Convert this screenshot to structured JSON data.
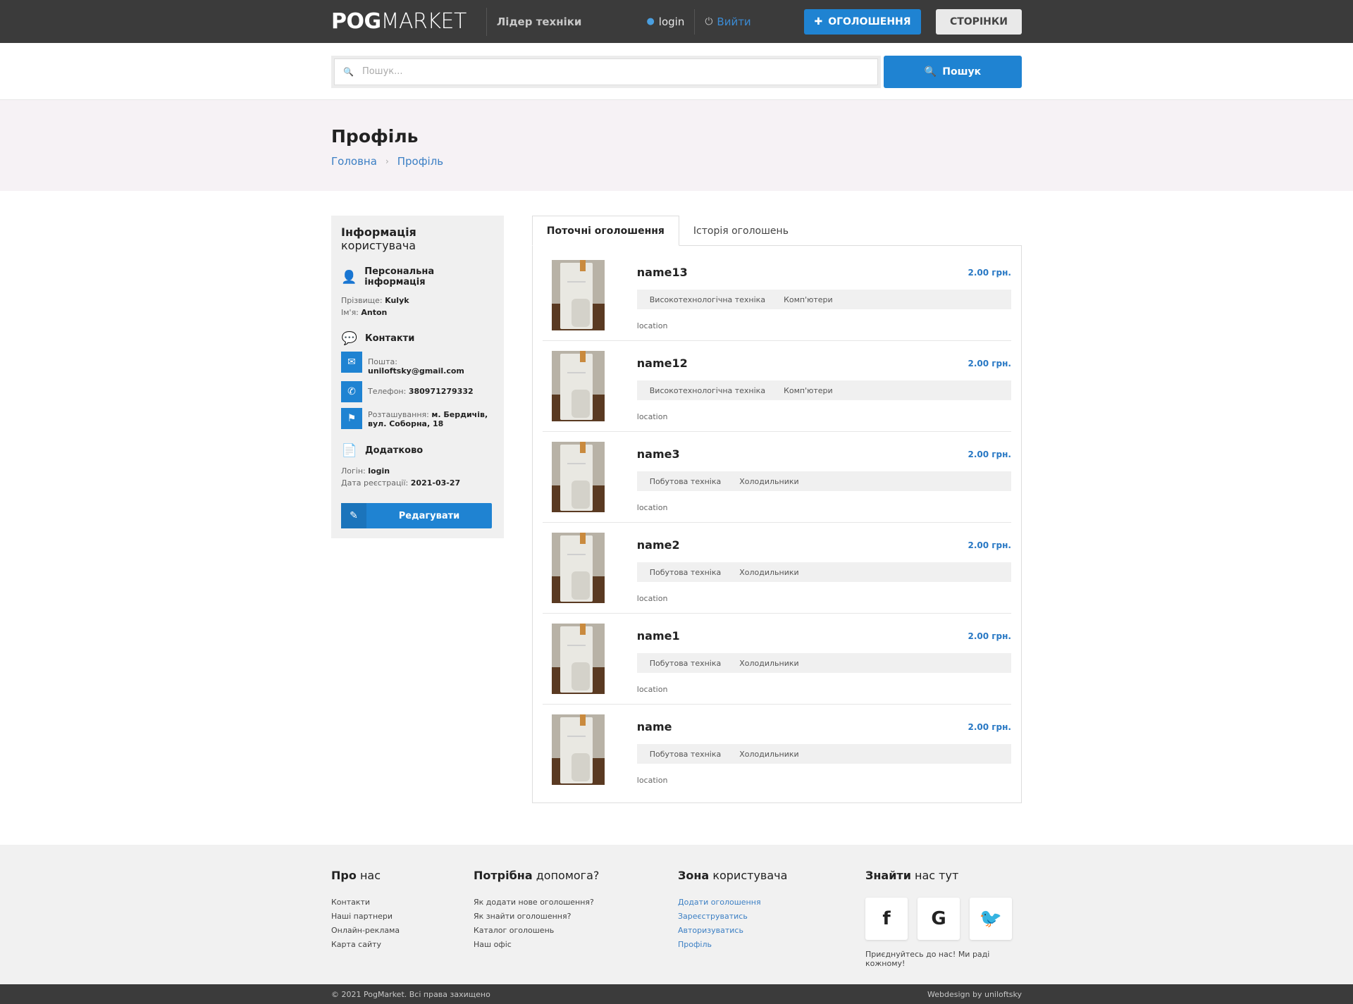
{
  "header": {
    "logo_bold": "POG",
    "logo_light": "MARKET",
    "tagline": "Лідер техніки",
    "user_login": "login",
    "logout_label": "Вийти",
    "add_ad_label": "ОГОЛОШЕННЯ",
    "pages_label": "СТОРІНКИ"
  },
  "search": {
    "placeholder": "Пошук...",
    "button_label": "Пошук"
  },
  "page": {
    "title": "Профіль",
    "breadcrumb": [
      "Головна",
      "Профіль"
    ]
  },
  "sidebar": {
    "title_bold": "Інформація",
    "title_light": "користувача",
    "personal_title": "Персональна інформація",
    "surname_label": "Прізвище:",
    "surname": "Kulyk",
    "name_label": "Ім'я:",
    "name": "Anton",
    "contacts_title": "Контакти",
    "email_label": "Пошта:",
    "email": "uniloftsky@gmail.com",
    "phone_label": "Телефон:",
    "phone": "380971279332",
    "location_label": "Розташування:",
    "location": "м. Бердичів, вул. Соборна, 18",
    "extra_title": "Додатково",
    "login_label": "Логін:",
    "login": "login",
    "reg_label": "Дата реєстрації:",
    "reg_date": "2021-03-27",
    "edit_label": "Редагувати"
  },
  "tabs": [
    "Поточні оголошення",
    "Історія оголошень"
  ],
  "listings": [
    {
      "name": "name13",
      "price": "2.00 грн.",
      "cat1": "Високотехнологічна техніка",
      "cat2": "Комп'ютери",
      "location": "location"
    },
    {
      "name": "name12",
      "price": "2.00 грн.",
      "cat1": "Високотехнологічна техніка",
      "cat2": "Комп'ютери",
      "location": "location"
    },
    {
      "name": "name3",
      "price": "2.00 грн.",
      "cat1": "Побутова техніка",
      "cat2": "Холодильники",
      "location": "location"
    },
    {
      "name": "name2",
      "price": "2.00 грн.",
      "cat1": "Побутова техніка",
      "cat2": "Холодильники",
      "location": "location"
    },
    {
      "name": "name1",
      "price": "2.00 грн.",
      "cat1": "Побутова техніка",
      "cat2": "Холодильники",
      "location": "location"
    },
    {
      "name": "name",
      "price": "2.00 грн.",
      "cat1": "Побутова техніка",
      "cat2": "Холодильники",
      "location": "location"
    }
  ],
  "footer": {
    "about_bold": "Про",
    "about_light": "нас",
    "about_links": [
      "Контакти",
      "Наші партнери",
      "Онлайн-реклама",
      "Карта сайту"
    ],
    "help_bold": "Потрібна",
    "help_light": "допомога?",
    "help_links": [
      "Як додати нове оголошення?",
      "Як знайти оголошення?",
      "Каталог оголошень",
      "Наш офіс"
    ],
    "zone_bold": "Зона",
    "zone_light": "користувача",
    "zone_links": [
      "Додати оголошення",
      "Зареєструватись",
      "Авторизуватись",
      "Профіль"
    ],
    "find_bold": "Знайти",
    "find_light": "нас тут",
    "social_note": "Приєднуйтесь до нас! Ми раді кожному!",
    "copyright": "© 2021 PogMarket. Всі права захищено",
    "credits": "Webdesign by uniloftsky"
  },
  "colors": {
    "accent": "#1f83d2",
    "topbar": "#3b3b3b",
    "title_band": "#f6f2f5"
  }
}
